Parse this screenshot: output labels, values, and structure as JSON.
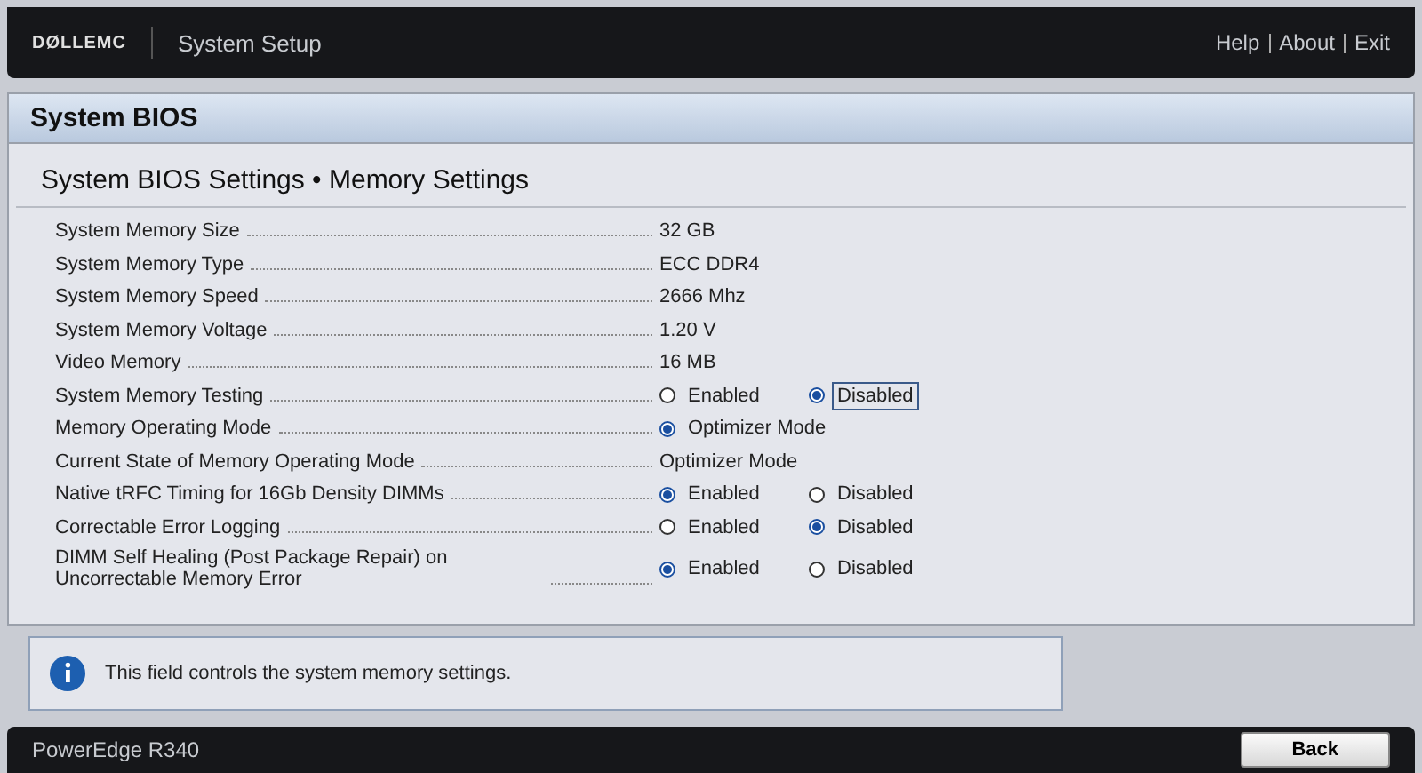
{
  "header": {
    "brand": "DØLLEMC",
    "title": "System Setup",
    "links": [
      "Help",
      "About",
      "Exit"
    ]
  },
  "panel": {
    "title": "System BIOS",
    "subtitle": "System BIOS Settings • Memory Settings"
  },
  "settings": [
    {
      "kind": "value",
      "label": "System Memory Size",
      "value": "32 GB"
    },
    {
      "kind": "value",
      "label": "System Memory Type",
      "value": "ECC DDR4"
    },
    {
      "kind": "value",
      "label": "System Memory Speed",
      "value": "2666 Mhz"
    },
    {
      "kind": "value",
      "label": "System Memory Voltage",
      "value": "1.20 V"
    },
    {
      "kind": "value",
      "label": "Video Memory",
      "value": "16 MB"
    },
    {
      "kind": "radio",
      "label": "System Memory Testing",
      "options": [
        {
          "label": "Enabled",
          "selected": false,
          "focused": false
        },
        {
          "label": "Disabled",
          "selected": true,
          "focused": true
        }
      ]
    },
    {
      "kind": "radio",
      "label": "Memory Operating Mode",
      "options": [
        {
          "label": "Optimizer Mode",
          "selected": true,
          "focused": false
        }
      ]
    },
    {
      "kind": "value",
      "label": "Current State of Memory Operating Mode",
      "value": "Optimizer Mode"
    },
    {
      "kind": "radio",
      "label": "Native tRFC Timing for 16Gb Density DIMMs",
      "options": [
        {
          "label": "Enabled",
          "selected": true,
          "focused": false
        },
        {
          "label": "Disabled",
          "selected": false,
          "focused": false
        }
      ]
    },
    {
      "kind": "radio",
      "label": "Correctable Error Logging",
      "options": [
        {
          "label": "Enabled",
          "selected": false,
          "focused": false
        },
        {
          "label": "Disabled",
          "selected": true,
          "focused": false
        }
      ]
    },
    {
      "kind": "radio",
      "label": "DIMM Self Healing (Post Package Repair) on Uncorrectable Memory Error",
      "options": [
        {
          "label": "Enabled",
          "selected": true,
          "focused": false
        },
        {
          "label": "Disabled",
          "selected": false,
          "focused": false
        }
      ]
    }
  ],
  "help": {
    "text": "This field controls the system memory settings."
  },
  "footer": {
    "model": "PowerEdge R340",
    "button": "Back"
  }
}
